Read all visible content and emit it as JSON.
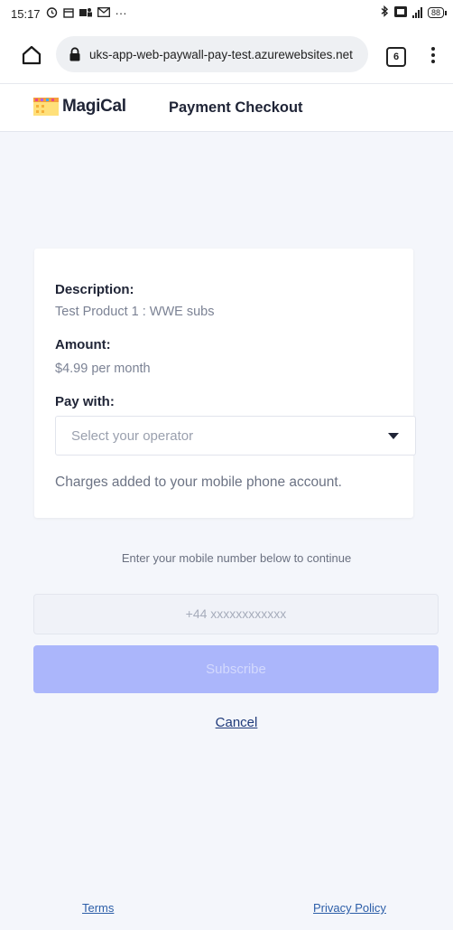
{
  "status_bar": {
    "time": "15:17",
    "left_icons": [
      "alarm-icon",
      "calendar-icon",
      "teams-icon",
      "gmail-icon",
      "more-notifications-icon"
    ],
    "more_glyph": "···",
    "right_icons": [
      "bluetooth-icon",
      "volte-icon",
      "4g-signal-icon",
      "battery-icon"
    ],
    "battery_level": "88"
  },
  "browser": {
    "url": "uks-app-web-paywall-pay-test.azurewebsites.net",
    "tab_count": "6"
  },
  "header": {
    "brand": "MagiCal",
    "title": "Payment Checkout"
  },
  "card": {
    "description_label": "Description:",
    "description_value": "Test Product 1 : WWE subs",
    "amount_label": "Amount:",
    "amount_value": "$4.99 per month",
    "pay_with_label": "Pay with:",
    "operator_select": {
      "placeholder": "Select your operator"
    },
    "charges_note": "Charges added to your mobile phone account."
  },
  "form": {
    "instruction": "Enter your mobile number below to continue",
    "phone_placeholder": "+44 xxxxxxxxxxxx",
    "subscribe_label": "Subscribe",
    "cancel_label": "Cancel"
  },
  "footer": {
    "terms_label": "Terms",
    "privacy_label": "Privacy Policy"
  },
  "colors": {
    "accent_button": "#abb6fb",
    "link": "#2c5ea8",
    "page_bg": "#f4f6fb"
  }
}
